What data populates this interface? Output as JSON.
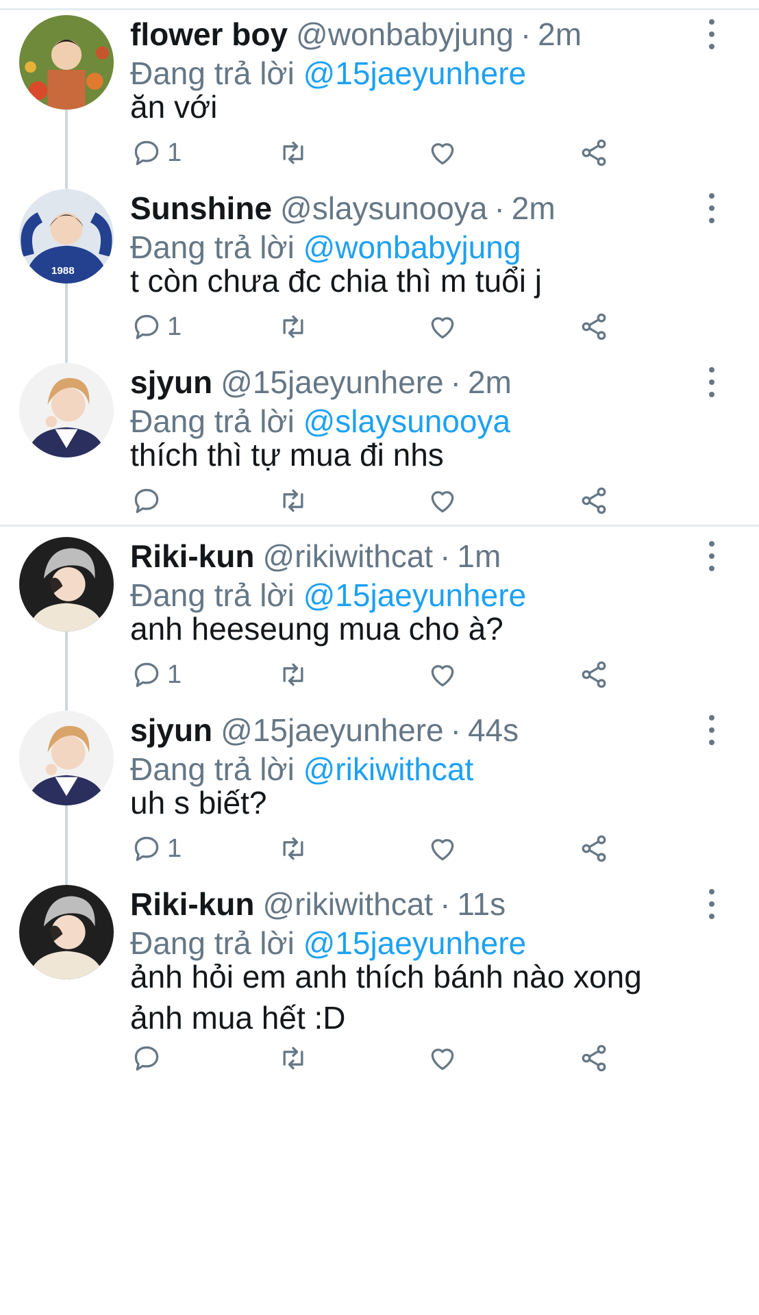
{
  "reply_prefix": "Đang trả lời",
  "tweets": [
    {
      "name": "flower boy",
      "handle": "@wonbabyjung",
      "time": "2m",
      "reply_to": "@15jaeyunhere",
      "text": "ăn với",
      "reply_count": "1",
      "avatar": "avatar-flower-garden"
    },
    {
      "name": "Sunshine",
      "handle": "@slaysunooya",
      "time": "2m",
      "reply_to": "@wonbabyjung",
      "text": "t còn chưa đc chia thì m tuổi j",
      "reply_count": "1",
      "avatar": "avatar-blue-sweater",
      "avatar_text": "1988"
    },
    {
      "name": "sjyun",
      "handle": "@15jaeyunhere",
      "time": "2m",
      "reply_to": "@slaysunooya",
      "text": "thích thì tự mua đi nhs",
      "reply_count": "",
      "avatar": "avatar-blond-hair"
    },
    {
      "name": "Riki-kun",
      "handle": "@rikiwithcat",
      "time": "1m",
      "reply_to": "@15jaeyunhere",
      "text": "anh heeseung mua cho à?",
      "reply_count": "1",
      "avatar": "avatar-beanie"
    },
    {
      "name": "sjyun",
      "handle": "@15jaeyunhere",
      "time": "44s",
      "reply_to": "@rikiwithcat",
      "text": "uh s biết?",
      "reply_count": "1",
      "avatar": "avatar-blond-hair"
    },
    {
      "name": "Riki-kun",
      "handle": "@rikiwithcat",
      "time": "11s",
      "reply_to": "@15jaeyunhere",
      "text": "ảnh hỏi em anh thích bánh nào xong\nảnh mua hết :D",
      "reply_count": "",
      "avatar": "avatar-beanie"
    }
  ],
  "colors": {
    "link": "#1da1f2",
    "muted": "#657786",
    "text": "#14171a",
    "thread_line": "#ccd6dd",
    "divider": "#e6ecf0"
  }
}
